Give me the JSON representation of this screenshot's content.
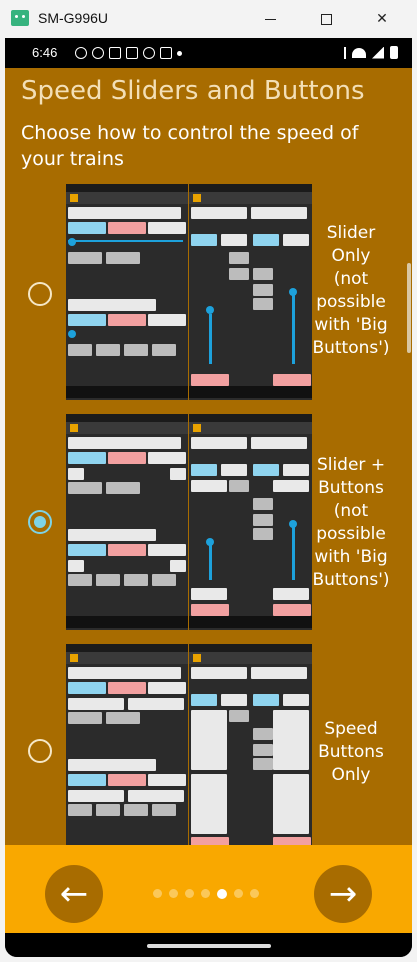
{
  "window": {
    "title": "SM-G996U",
    "minimize_label": "",
    "maximize_label": "",
    "close_label": "✕"
  },
  "status_bar": {
    "time": "6:46"
  },
  "page": {
    "title": "Speed Sliders and Buttons",
    "subtitle": "Choose how to control the speed of your trains"
  },
  "options": [
    {
      "label": "Slider\nOnly\n(not\npossible\nwith 'Big\nButtons')",
      "selected": false
    },
    {
      "label": "Slider +\nButtons\n(not\npossible\nwith 'Big\nButtons')",
      "selected": true
    },
    {
      "label": "Speed\nButtons\nOnly",
      "selected": false
    }
  ],
  "navigation": {
    "prev_icon": "←",
    "next_icon": "→",
    "page_count": 7,
    "current_page": 5
  },
  "colors": {
    "background": "#a86c00",
    "bottom_bar": "#f9a800",
    "radio_selected": "#7ed3e6"
  }
}
